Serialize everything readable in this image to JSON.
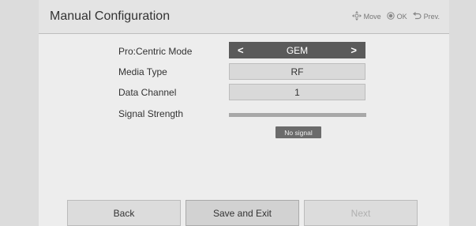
{
  "header": {
    "title": "Manual Configuration",
    "hints": [
      {
        "icon": "dpad-icon",
        "label": "Move"
      },
      {
        "icon": "ok-icon",
        "label": "OK"
      },
      {
        "icon": "back-arrow-icon",
        "label": "Prev."
      }
    ]
  },
  "rows": {
    "mode": {
      "label": "Pro:Centric Mode",
      "value": "GEM",
      "left_icon": "chevron-left-icon",
      "right_icon": "chevron-right-icon"
    },
    "media": {
      "label": "Media Type",
      "value": "RF"
    },
    "channel": {
      "label": "Data Channel",
      "value": "1"
    },
    "signal": {
      "label": "Signal Strength",
      "status": "No signal",
      "level": 0
    }
  },
  "buttons": {
    "back": "Back",
    "save": "Save and Exit",
    "next": "Next"
  },
  "colors": {
    "selected_field": "#5a5a5a",
    "field": "#d9d9d9",
    "panel": "#ededed",
    "background": "#dcdcdc"
  }
}
